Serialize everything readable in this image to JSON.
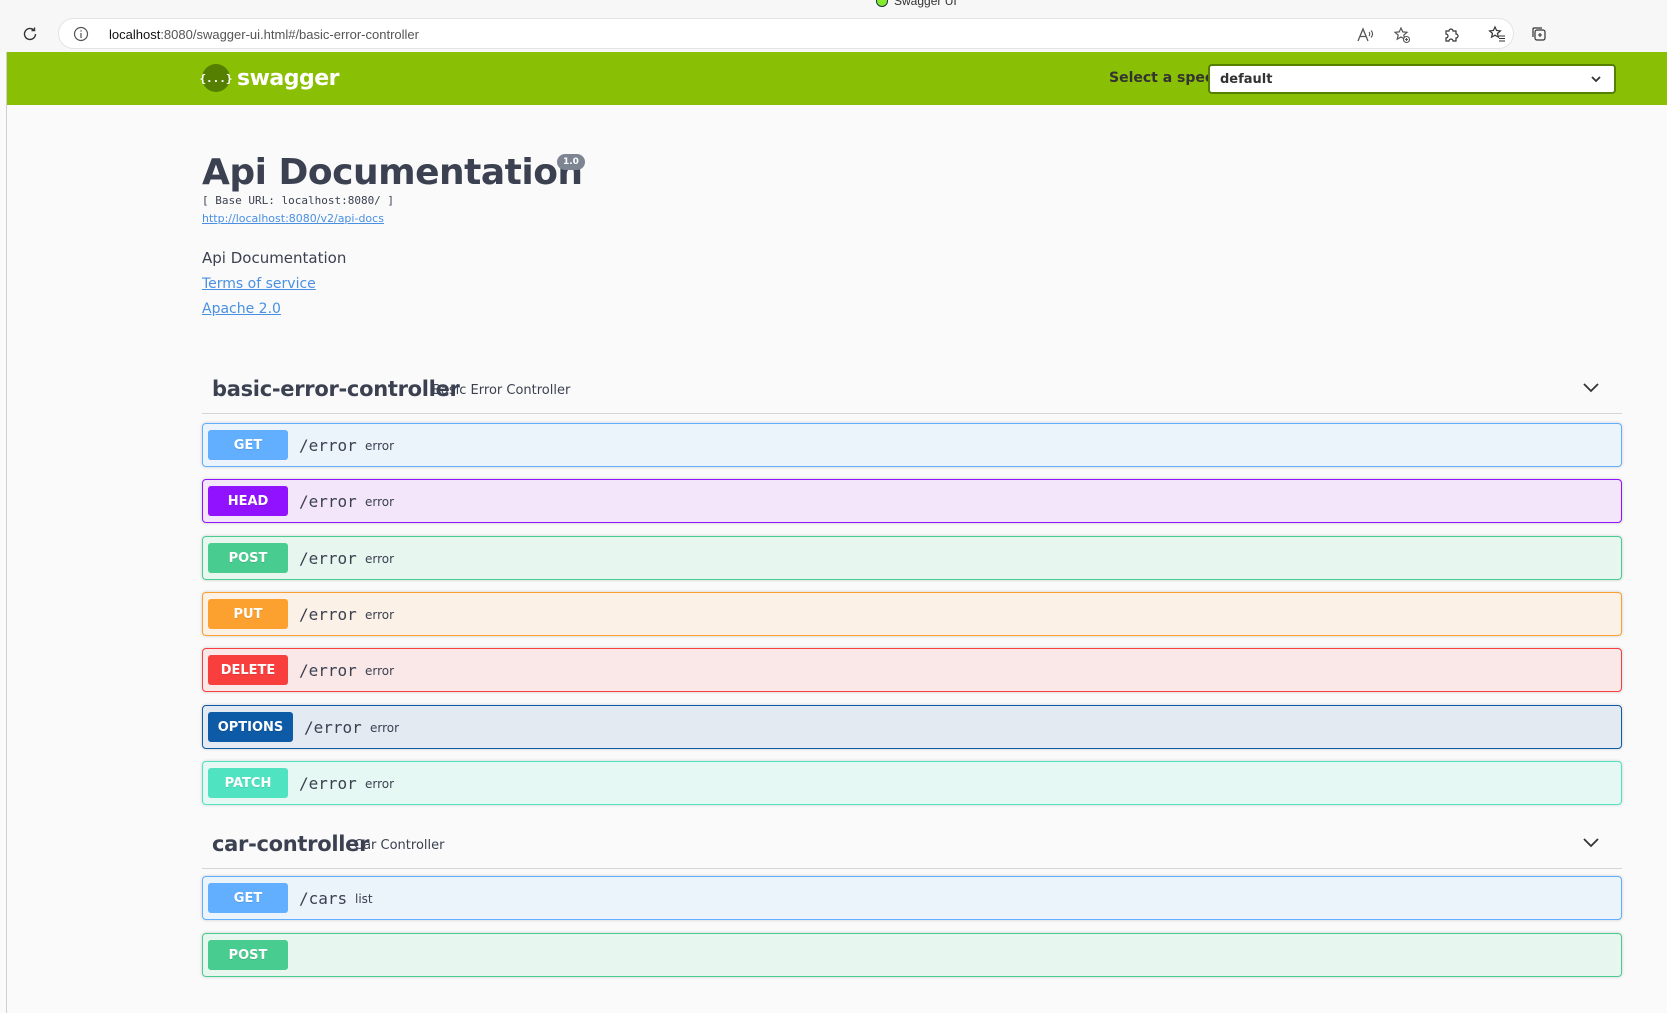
{
  "browser": {
    "tab_title": "Swagger UI",
    "url_host": "localhost",
    "url_rest": ":8080/swagger-ui.html#/basic-error-controller"
  },
  "topbar": {
    "logo_text": "swagger",
    "logo_glyph": "{...}",
    "spec_label": "Select a spec",
    "spec_value": "default"
  },
  "info": {
    "title": "Api Documentation",
    "version": "1.0",
    "base_url": "[ Base URL: localhost:8080/ ]",
    "api_docs_link": "http://localhost:8080/v2/api-docs",
    "description": "Api Documentation",
    "terms_of_service": "Terms of service",
    "license": "Apache 2.0"
  },
  "tags": [
    {
      "name": "basic-error-controller",
      "description": "Basic Error Controller",
      "operations": [
        {
          "method": "GET",
          "path": "/error",
          "summary": "error"
        },
        {
          "method": "HEAD",
          "path": "/error",
          "summary": "error"
        },
        {
          "method": "POST",
          "path": "/error",
          "summary": "error"
        },
        {
          "method": "PUT",
          "path": "/error",
          "summary": "error"
        },
        {
          "method": "DELETE",
          "path": "/error",
          "summary": "error"
        },
        {
          "method": "OPTIONS",
          "path": "/error",
          "summary": "error"
        },
        {
          "method": "PATCH",
          "path": "/error",
          "summary": "error"
        }
      ]
    },
    {
      "name": "car-controller",
      "description": "Car Controller",
      "operations": [
        {
          "method": "GET",
          "path": "/cars",
          "summary": "list"
        },
        {
          "method": "POST",
          "path": "",
          "summary": ""
        }
      ]
    }
  ],
  "colors": {
    "topbar": "#89bf04",
    "get": "#61affe",
    "head": "#9012fe",
    "post": "#49cc90",
    "put": "#fca130",
    "delete": "#f93e3e",
    "options": "#0d5aa7",
    "patch": "#50e3c2"
  }
}
